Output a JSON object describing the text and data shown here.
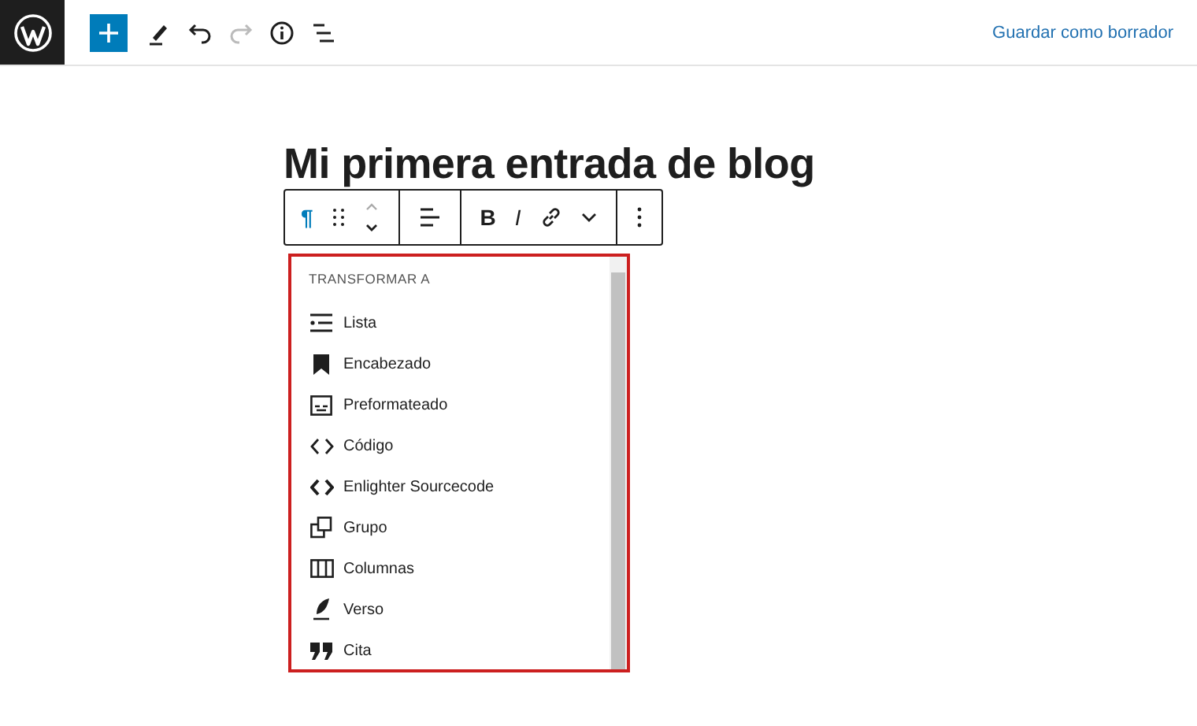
{
  "topbar": {
    "tools": [
      {
        "kind": "add",
        "selected": true
      },
      {
        "kind": "pen",
        "selected": false
      },
      {
        "kind": "undo",
        "selected": false
      },
      {
        "kind": "redo",
        "selected": false
      },
      {
        "kind": "info",
        "selected": false
      },
      {
        "kind": "outline",
        "selected": false
      }
    ],
    "save_draft": "Guardar como borrador"
  },
  "post_title": "Mi primera entrada de blog",
  "block_toolbar": {
    "groups": [
      [
        {
          "kind": "paragraph",
          "text": "¶",
          "active": true
        },
        {
          "kind": "drag"
        },
        {
          "kind": "mover"
        }
      ],
      [
        {
          "kind": "align"
        }
      ],
      [
        {
          "kind": "bold",
          "text": "B",
          "active": false
        },
        {
          "kind": "italic",
          "text": "I",
          "active": false
        },
        {
          "kind": "link"
        },
        {
          "kind": "more-down"
        }
      ],
      [
        {
          "kind": "options"
        }
      ]
    ]
  },
  "transform_menu": {
    "heading": "TRANSFORMAR A",
    "items": [
      {
        "kind": "list",
        "label": "Lista"
      },
      {
        "kind": "heading",
        "label": "Encabezado"
      },
      {
        "kind": "preformatted",
        "label": "Preformateado"
      },
      {
        "kind": "code",
        "label": "Código"
      },
      {
        "kind": "code-bold",
        "label": "Enlighter Sourcecode"
      },
      {
        "kind": "group",
        "label": "Grupo"
      },
      {
        "kind": "columns",
        "label": "Columnas"
      },
      {
        "kind": "verse",
        "label": "Verso"
      },
      {
        "kind": "quote",
        "label": "Cita"
      }
    ]
  }
}
